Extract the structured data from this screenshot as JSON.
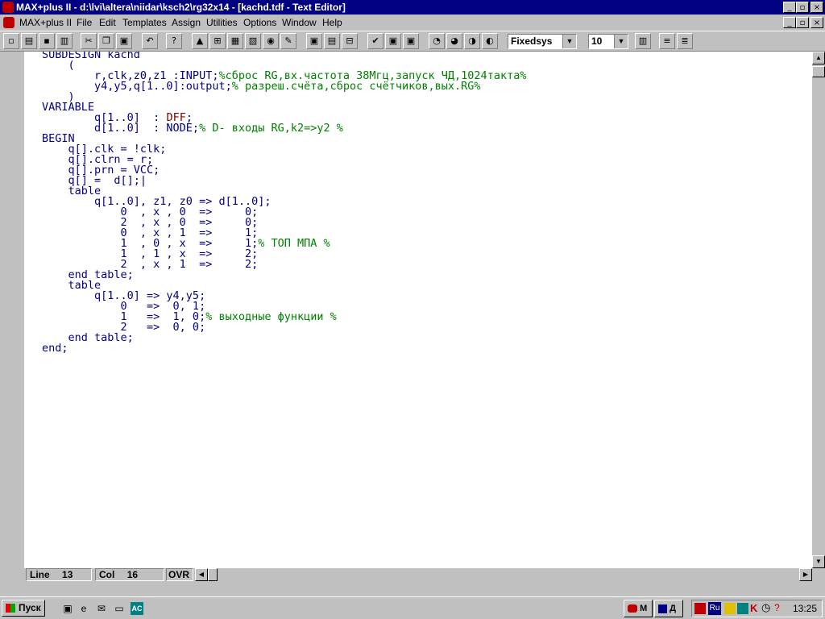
{
  "window": {
    "title": "MAX+plus II - d:\\lvi\\altera\\niidar\\ksch2\\rg32x14 - [kachd.tdf - Text Editor]",
    "min_glyph": "_",
    "max_glyph": "▫",
    "close_glyph": "×"
  },
  "menu": {
    "items": [
      "MAX+plus II",
      "File",
      "Edit",
      "Templates",
      "Assign",
      "Utilities",
      "Options",
      "Window",
      "Help"
    ]
  },
  "toolbar": {
    "font_value": "Fixedsys",
    "size_value": "10"
  },
  "code": [
    {
      "t": "SUBDESIGN kachd"
    },
    {
      "t": "    ("
    },
    {
      "t": "        r,clk,z0,z1 :INPUT;",
      "c": "%сброс RG,вх.частота 38Мгц,запуск ЧД,1024такта%"
    },
    {
      "t": "        y4,y5,q[1..0]:output;",
      "c": "% разреш.счёта,сброс счётчиков,вых.RG%"
    },
    {
      "t": "    )"
    },
    {
      "t": "VARIABLE"
    },
    {
      "t": "        q[1..0]  : ",
      "k": "DFF",
      "a": ";"
    },
    {
      "t": "        d[1..0]  : NODE;",
      "c": "% D- входы RG,k2=>y2 %"
    },
    {
      "t": "BEGIN"
    },
    {
      "t": "    q[].clk = !clk;"
    },
    {
      "t": "    q[].clrn = r;"
    },
    {
      "t": "    q[].prn = VCC;"
    },
    {
      "t": "    q[] =  d[];|"
    },
    {
      "t": "    table"
    },
    {
      "t": "        q[1..0], z1, z0 => d[1..0];"
    },
    {
      "t": "            0  , x , 0  =>     0;"
    },
    {
      "t": "            2  , x , 0  =>     0;"
    },
    {
      "t": "            0  , x , 1  =>     1;"
    },
    {
      "t": "            1  , 0 , x  =>     1;",
      "c": "% ТОП МПА %"
    },
    {
      "t": "            1  , 1 , x  =>     2;"
    },
    {
      "t": "            2  , x , 1  =>     2;"
    },
    {
      "t": "    end table;"
    },
    {
      "t": "    table"
    },
    {
      "t": "        q[1..0] => y4,y5;"
    },
    {
      "t": "            0   =>  0, 1;"
    },
    {
      "t": "            1   =>  1, 0;",
      "c": "% выходные функции %"
    },
    {
      "t": "            2   =>  0, 0;"
    },
    {
      "t": "    end table;"
    },
    {
      "t": "end;"
    }
  ],
  "status": {
    "line_label": "Line",
    "line_value": "13",
    "col_label": "Col",
    "col_value": "16",
    "mode": "OVR"
  },
  "taskbar": {
    "start_label": "Пуск",
    "task1_label": "M",
    "task2_label": "Д",
    "tray_lang": "Ru",
    "clock": "13:25"
  },
  "colors": {
    "titlebar": "#000080",
    "code_text": "#000080",
    "comment": "#008000",
    "keyword": "#800000"
  }
}
